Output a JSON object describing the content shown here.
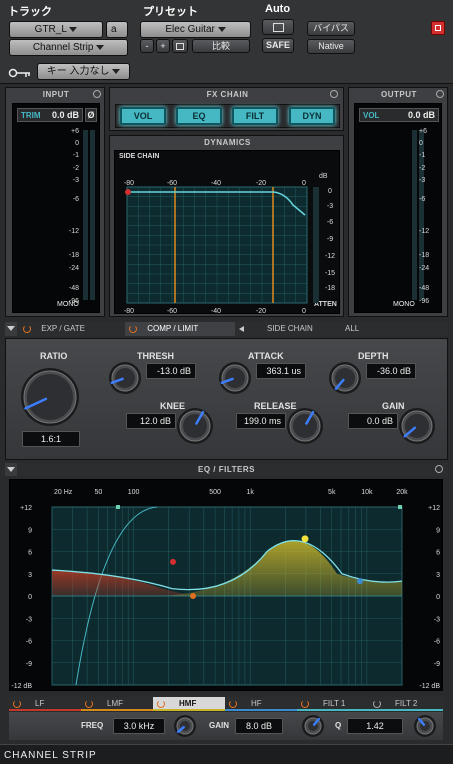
{
  "header": {
    "track_label": "トラック",
    "preset_label": "プリセット",
    "auto_label": "Auto",
    "track_name": "GTR_L",
    "track_suffix": "a",
    "plugin_name": "Channel Strip",
    "preset_name": "Elec Guitar",
    "minus": "-",
    "plus": "+",
    "compare": "比較",
    "safe": "SAFE",
    "bypass": "バイパス",
    "native": "Native",
    "key_input": "キー 入力なし"
  },
  "input": {
    "title": "INPUT",
    "trim_label": "TRIM",
    "trim_value": "0.0 dB",
    "phase": "Ø",
    "scale": [
      "+6",
      "0",
      "-1",
      "-2",
      "-3",
      "-6",
      "-12",
      "-18",
      "-24",
      "-48",
      "-96"
    ],
    "mono": "MONO"
  },
  "output": {
    "title": "OUTPUT",
    "vol_label": "VOL",
    "vol_value": "0.0 dB",
    "scale": [
      "+6",
      "0",
      "-1",
      "-2",
      "-3",
      "-6",
      "-12",
      "-18",
      "-24",
      "-48",
      "-96"
    ],
    "mono": "MONO"
  },
  "fx_chain": {
    "title": "FX CHAIN",
    "buttons": [
      "VOL",
      "EQ",
      "FILT",
      "DYN"
    ]
  },
  "dynamics": {
    "title": "DYNAMICS",
    "side_chain_label": "SIDE CHAIN",
    "top_ticks": [
      "-80",
      "-60",
      "-40",
      "-20",
      "0"
    ],
    "bottom_ticks": [
      "-80",
      "-60",
      "-40",
      "-20",
      "0"
    ],
    "db_label": "dB",
    "right_ticks": [
      "0",
      "-3",
      "-6",
      "-9",
      "-12",
      "-15",
      "-18"
    ],
    "atten_label": "ATTEN"
  },
  "dyn_tabs": {
    "exp_gate": "EXP / GATE",
    "comp_limit": "COMP / LIMIT",
    "side_chain": "SIDE CHAIN",
    "all": "ALL"
  },
  "controls": {
    "ratio_label": "RATIO",
    "ratio_value": "1.6:1",
    "thresh_label": "THRESH",
    "thresh_value": "-13.0 dB",
    "attack_label": "ATTACK",
    "attack_value": "363.1 us",
    "depth_label": "DEPTH",
    "depth_value": "-36.0 dB",
    "knee_label": "KNEE",
    "knee_value": "12.0 dB",
    "release_label": "RELEASE",
    "release_value": "199.0 ms",
    "gain_label": "GAIN",
    "gain_value": "0.0 dB"
  },
  "eq": {
    "title": "EQ / FILTERS",
    "freq_ticks": [
      "20 Hz",
      "50",
      "100",
      "500",
      "1k",
      "5k",
      "10k",
      "20k"
    ],
    "db_ticks": [
      "+12",
      "9",
      "6",
      "3",
      "0",
      "-3",
      "-6",
      "-9",
      "-12 dB"
    ],
    "db_ticks_right": [
      "+12",
      "9",
      "6",
      "3",
      "0",
      "-3",
      "-6",
      "-9",
      "-12 dB"
    ],
    "bands": [
      "LF",
      "LMF",
      "HMF",
      "HF",
      "FILT 1",
      "FILT 2"
    ],
    "freq_label": "FREQ",
    "freq_value": "3.0 kHz",
    "gain_label": "GAIN",
    "gain_value": "8.0 dB",
    "q_label": "Q",
    "q_value": "1.42"
  },
  "footer": {
    "title": "CHANNEL STRIP"
  },
  "colors": {
    "accent": "#46b8c4",
    "knob_indicator": "#3d7dff",
    "power": "#e07020",
    "close": "#d23030"
  }
}
